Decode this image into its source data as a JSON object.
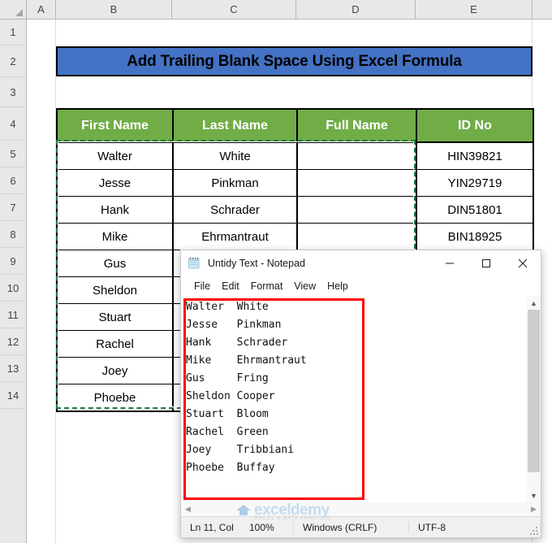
{
  "app": {
    "name": "Microsoft Excel",
    "banner_color": "#4472C4",
    "header_color": "#70AD47",
    "selection_color": "#1F7A3F",
    "highlight_color": "#FF0000"
  },
  "spreadsheet": {
    "column_headers": [
      "A",
      "B",
      "C",
      "D",
      "E"
    ],
    "row_headers": [
      "1",
      "2",
      "3",
      "4",
      "5",
      "6",
      "7",
      "8",
      "9",
      "10",
      "11",
      "12",
      "13",
      "14"
    ],
    "banner_title": "Add Trailing Blank Space Using Excel Formula",
    "table": {
      "columns": [
        "First Name",
        "Last Name",
        "Full Name",
        "ID No"
      ],
      "rows": [
        {
          "first_name": "Walter",
          "last_name": "White",
          "full_name": "",
          "id_no": "HIN39821"
        },
        {
          "first_name": "Jesse",
          "last_name": "Pinkman",
          "full_name": "",
          "id_no": "YIN29719"
        },
        {
          "first_name": "Hank",
          "last_name": "Schrader",
          "full_name": "",
          "id_no": "DIN51801"
        },
        {
          "first_name": "Mike",
          "last_name": "Ehrmantraut",
          "full_name": "",
          "id_no": "BIN18925"
        },
        {
          "first_name": "Gus",
          "last_name": "Fring",
          "full_name": "",
          "id_no": ""
        },
        {
          "first_name": "Sheldon",
          "last_name": "Cooper",
          "full_name": "",
          "id_no": ""
        },
        {
          "first_name": "Stuart",
          "last_name": "Bloom",
          "full_name": "",
          "id_no": ""
        },
        {
          "first_name": "Rachel",
          "last_name": "Green",
          "full_name": "",
          "id_no": ""
        },
        {
          "first_name": "Joey",
          "last_name": "Tribbiani",
          "full_name": "",
          "id_no": ""
        },
        {
          "first_name": "Phoebe",
          "last_name": "Buffay",
          "full_name": "",
          "id_no": ""
        }
      ]
    }
  },
  "notepad": {
    "title": "Untidy Text - Notepad",
    "icon": "notepad-icon",
    "window_controls": {
      "minimize": "minimize-icon",
      "maximize": "maximize-icon",
      "close": "close-icon"
    },
    "menu": [
      "File",
      "Edit",
      "Format",
      "View",
      "Help"
    ],
    "content": "Walter  White\nJesse   Pinkman\nHank    Schrader\nMike    Ehrmantraut\nGus     Fring\nSheldon Cooper\nStuart  Bloom\nRachel  Green\nJoey    Tribbiani\nPhoebe  Buffay",
    "status_bar": {
      "position": "Ln 11, Col",
      "zoom": "100%",
      "line_ending": "Windows (CRLF)",
      "encoding": "UTF-8"
    }
  },
  "watermark": {
    "text": "exceldemy",
    "subtext": "EXCEL & DATA ANALYSIS"
  }
}
